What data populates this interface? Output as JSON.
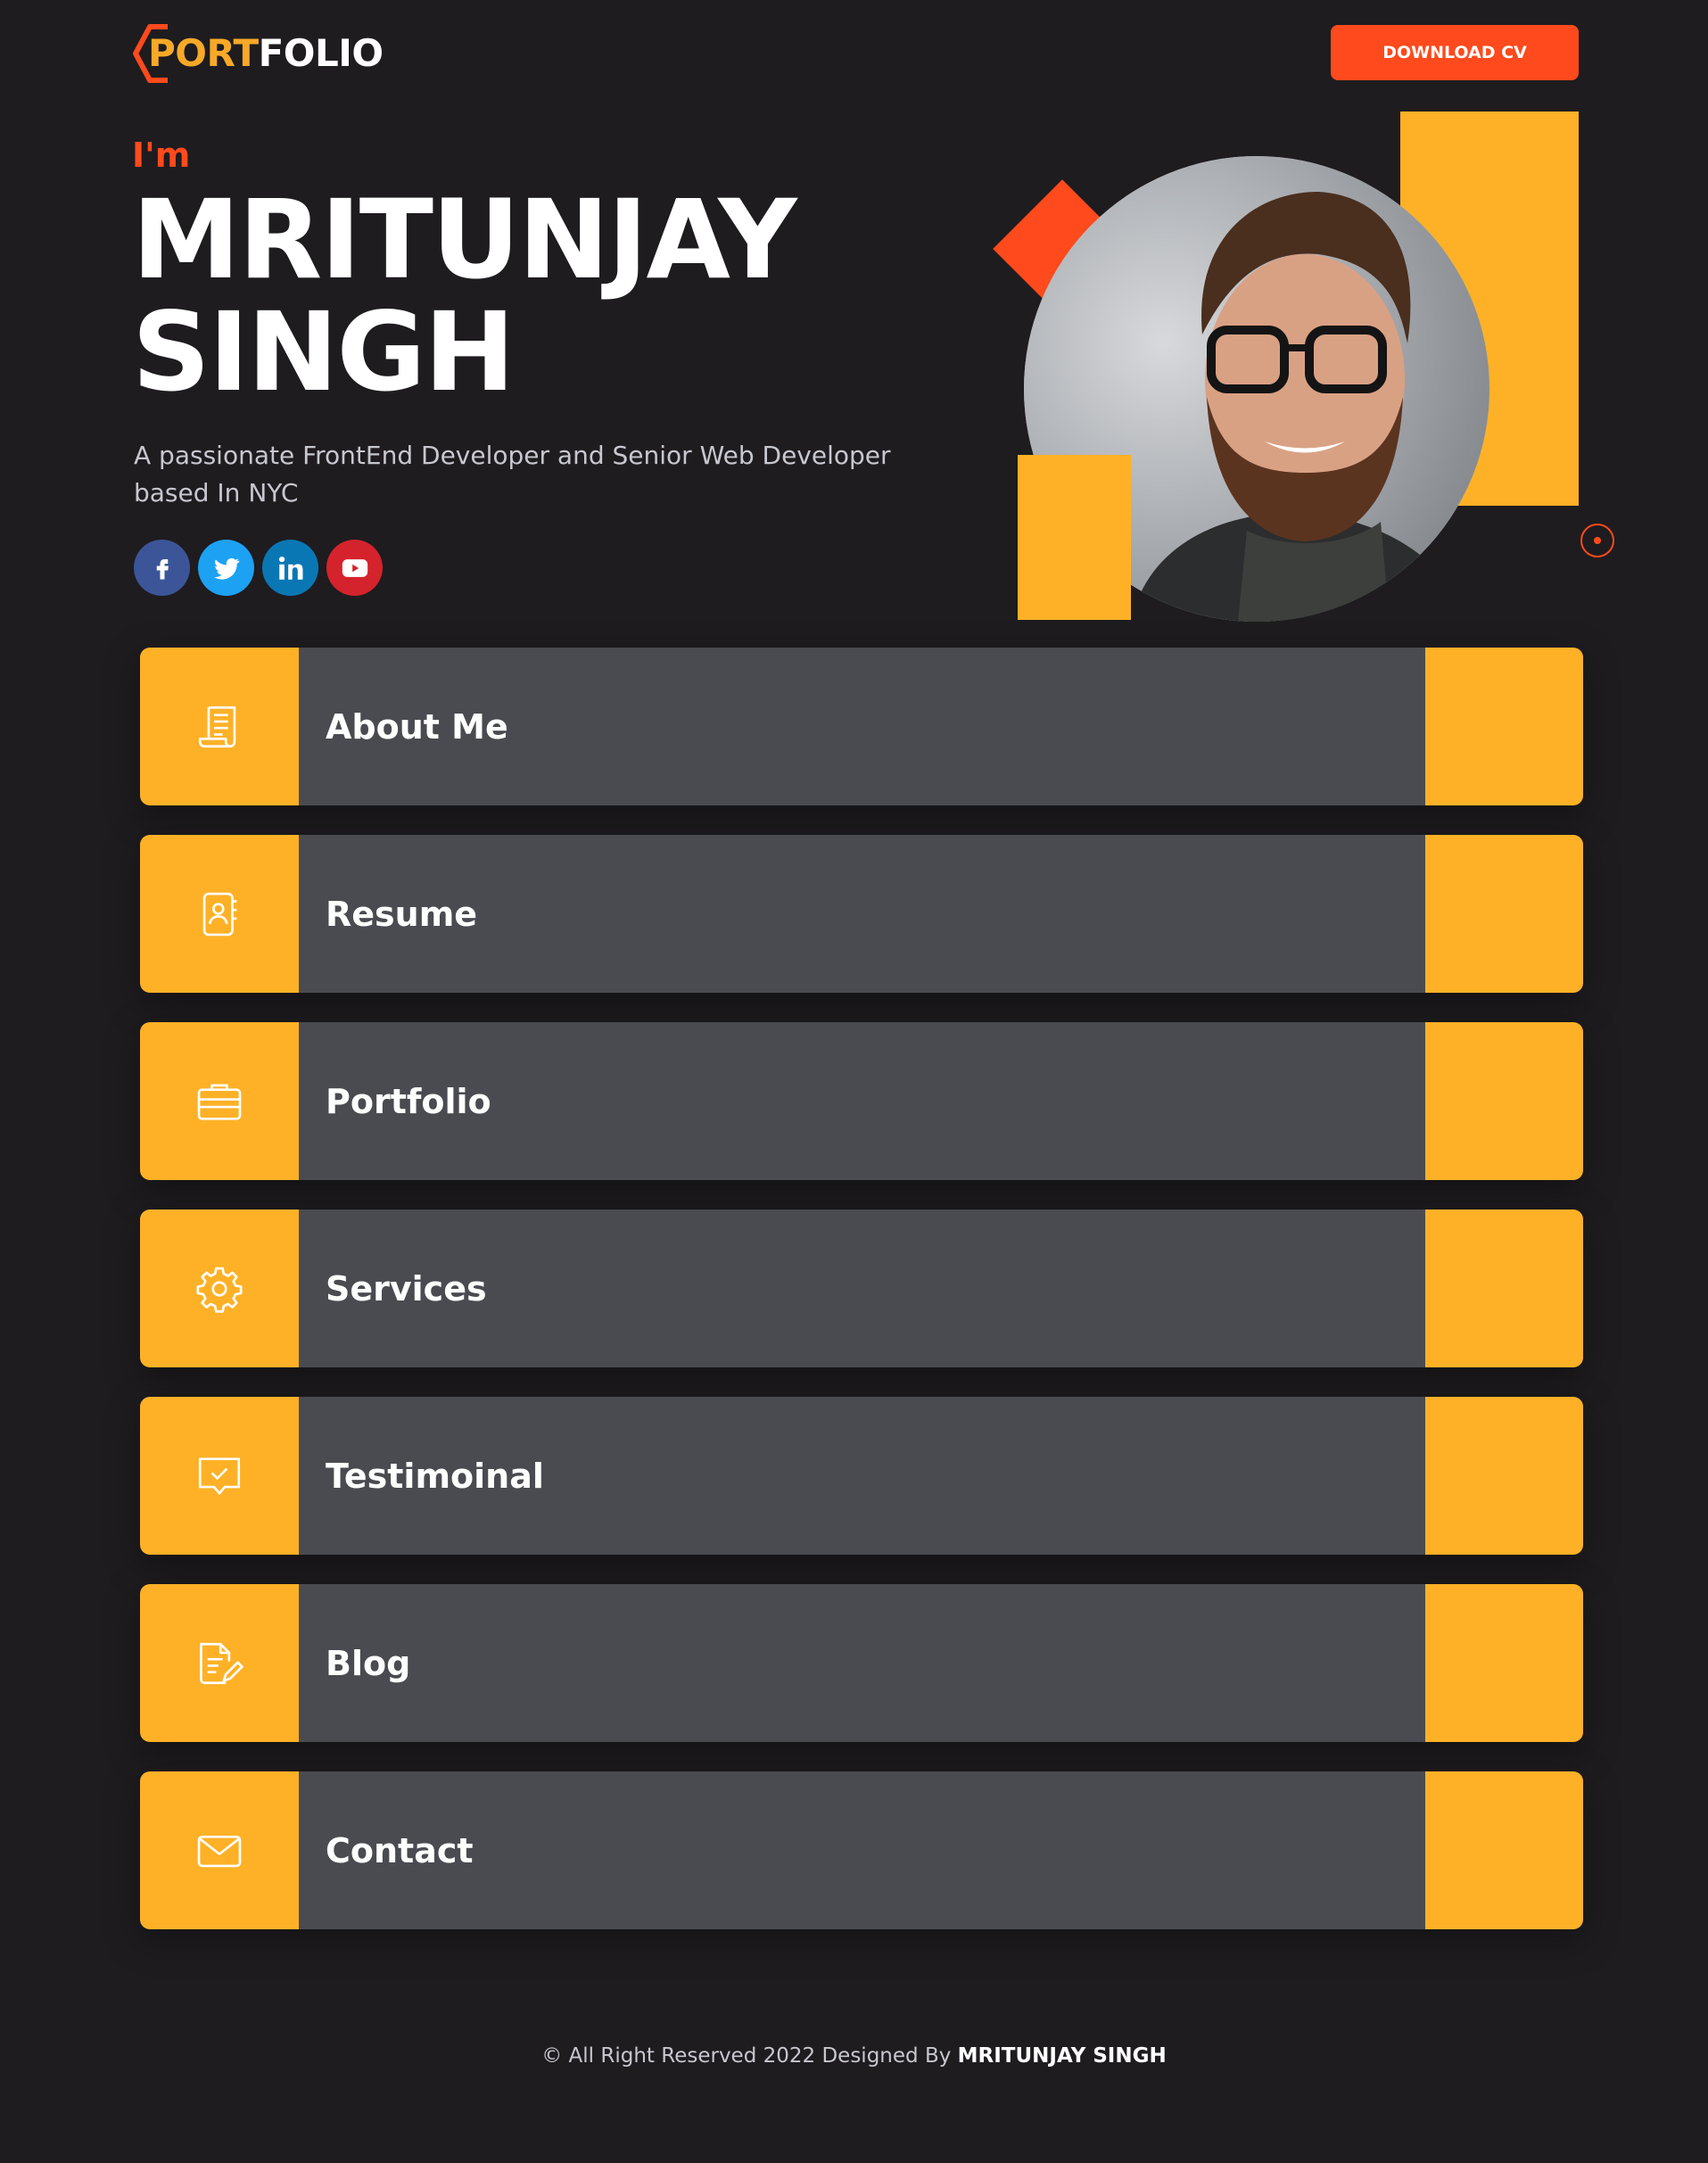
{
  "header": {
    "logo_part1": "PORT",
    "logo_part2": "FOLIO",
    "download_label": "DOWNLOAD CV"
  },
  "hero": {
    "greeting": "I'm",
    "name_line1": "MRITUNJAY",
    "name_line2": "SINGH",
    "intro": "A passionate FrontEnd Developer and Senior Web Developer based In NYC"
  },
  "socials": [
    {
      "name": "facebook",
      "icon": "facebook-icon",
      "color": "#3b5598"
    },
    {
      "name": "twitter",
      "icon": "twitter-icon",
      "color": "#1da1f2"
    },
    {
      "name": "linkedin",
      "icon": "linkedin-icon",
      "color": "#0a77b5"
    },
    {
      "name": "youtube",
      "icon": "youtube-icon",
      "color": "#d4232c"
    }
  ],
  "menu": {
    "items": [
      {
        "label": "About Me",
        "icon": "document-icon"
      },
      {
        "label": "Resume",
        "icon": "contact-book-icon"
      },
      {
        "label": "Portfolio",
        "icon": "briefcase-icon"
      },
      {
        "label": "Services",
        "icon": "gear-icon"
      },
      {
        "label": "Testimoinal",
        "icon": "chat-check-icon"
      },
      {
        "label": "Blog",
        "icon": "edit-note-icon"
      },
      {
        "label": "Contact",
        "icon": "mail-icon"
      }
    ]
  },
  "footer": {
    "text": "© All Right Reserved 2022 Designed By",
    "author": "MRITUNJAY SINGH"
  },
  "colors": {
    "background": "#1e1c1f",
    "accent_orange": "#fe4a1c",
    "accent_yellow": "#feb126",
    "card_gray": "#4a4b50"
  }
}
